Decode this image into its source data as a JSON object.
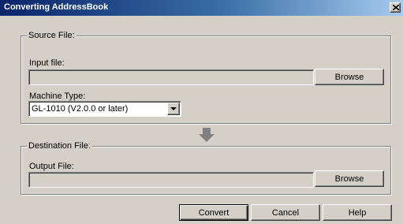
{
  "window": {
    "title": "Converting AddressBook",
    "close_icon": "close-icon",
    "titlebar_colors": [
      "#0a246a",
      "#a6caf0"
    ]
  },
  "source": {
    "legend": "Source File:",
    "input_label": "Input file:",
    "input_value": "",
    "browse_label": "Browse",
    "machine_label": "Machine Type:",
    "machine_value": "GL-1010 (V2.0.0 or later)"
  },
  "arrow_icon": "down-arrow-icon",
  "destination": {
    "legend": "Destination File:",
    "output_label": "Output File:",
    "output_value": "",
    "browse_label": "Browse"
  },
  "buttons": {
    "convert": "Convert",
    "cancel": "Cancel",
    "help": "Help"
  }
}
